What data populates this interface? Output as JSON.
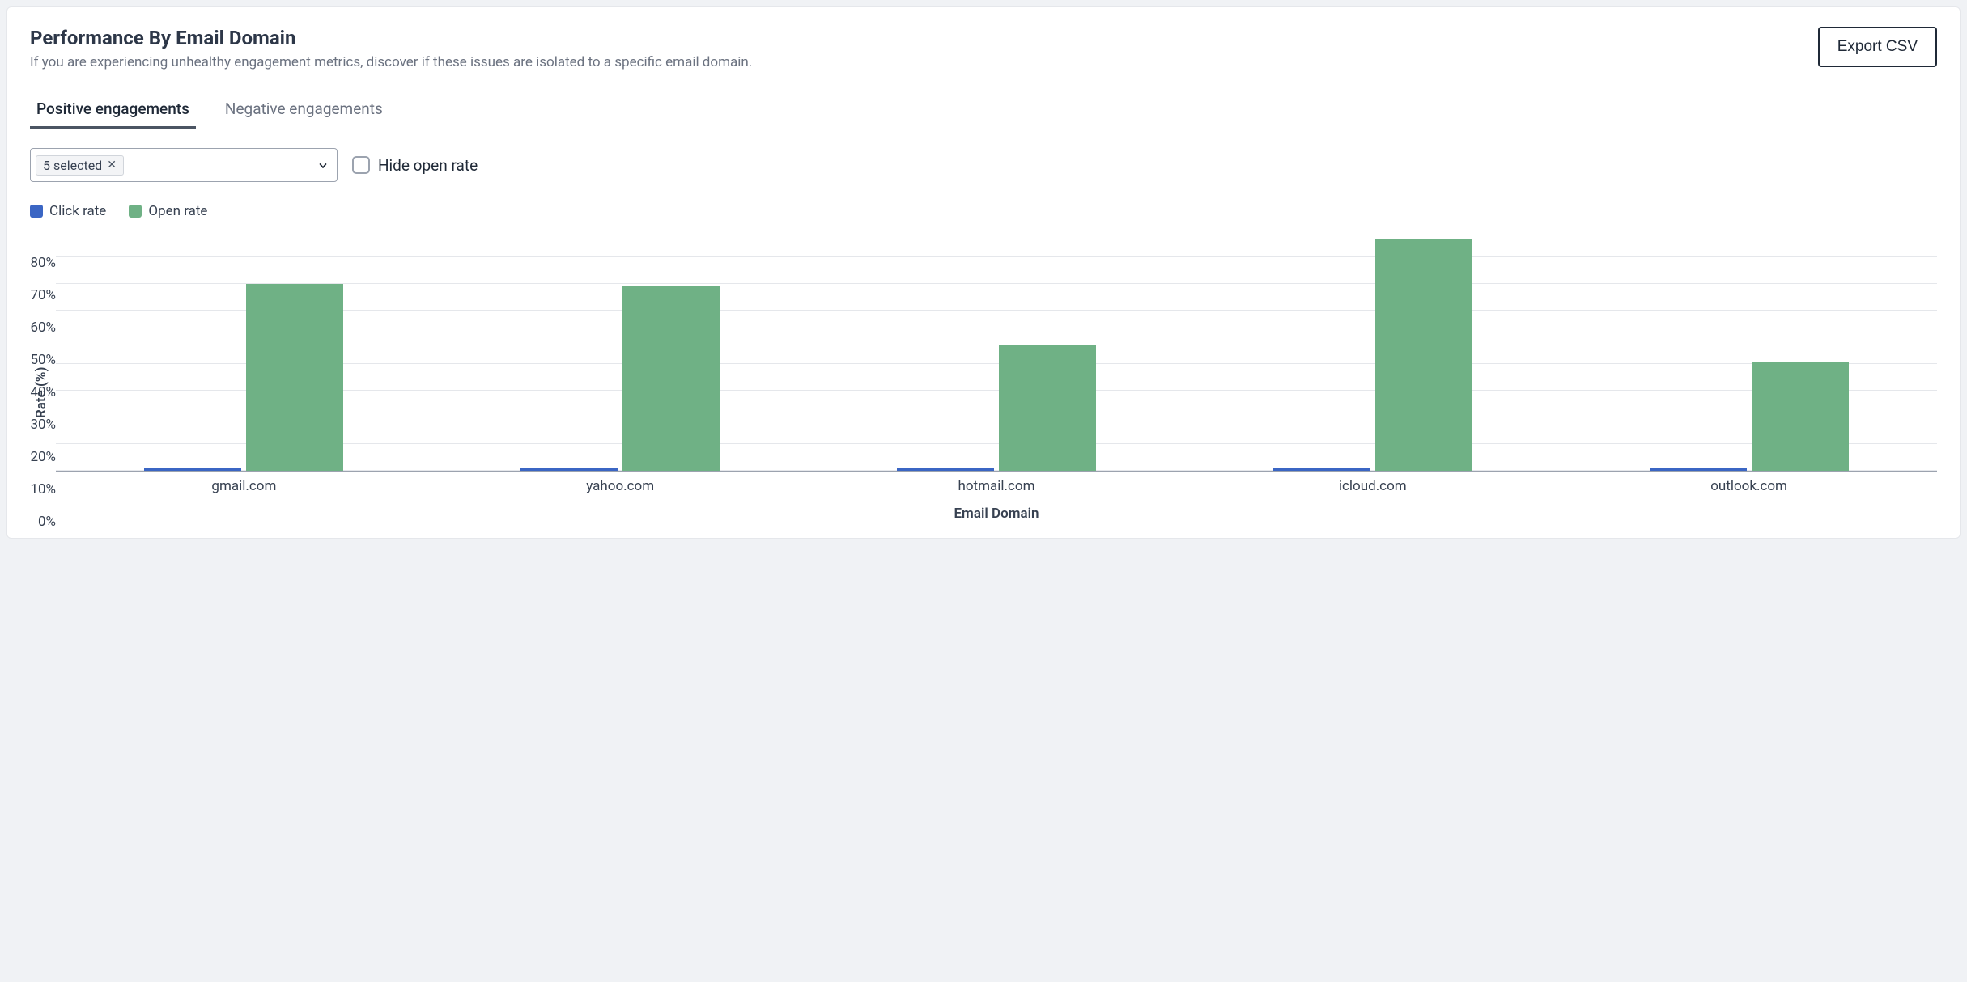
{
  "header": {
    "title": "Performance By Email Domain",
    "subtitle": "If you are experiencing unhealthy engagement metrics, discover if these issues are isolated to a specific email domain.",
    "export_label": "Export CSV"
  },
  "tabs": [
    {
      "label": "Positive engagements",
      "active": true
    },
    {
      "label": "Negative engagements",
      "active": false
    }
  ],
  "controls": {
    "select_chip_label": "5 selected",
    "hide_open_rate_label": "Hide open rate",
    "hide_open_rate_checked": false
  },
  "legend": [
    {
      "label": "Click rate",
      "color": "#3b66c4"
    },
    {
      "label": "Open rate",
      "color": "#6fb185"
    }
  ],
  "chart_data": {
    "type": "bar",
    "xlabel": "Email Domain",
    "ylabel": "Rate (%)",
    "ylim": [
      0,
      90
    ],
    "yticks": [
      0,
      10,
      20,
      30,
      40,
      50,
      60,
      70,
      80
    ],
    "ytick_suffix": "%",
    "categories": [
      "gmail.com",
      "yahoo.com",
      "hotmail.com",
      "icloud.com",
      "outlook.com"
    ],
    "series": [
      {
        "name": "Click rate",
        "color": "#3b66c4",
        "values": [
          1,
          1,
          1,
          1,
          1
        ]
      },
      {
        "name": "Open rate",
        "color": "#6fb185",
        "values": [
          70,
          69,
          47,
          87,
          41
        ]
      }
    ]
  }
}
